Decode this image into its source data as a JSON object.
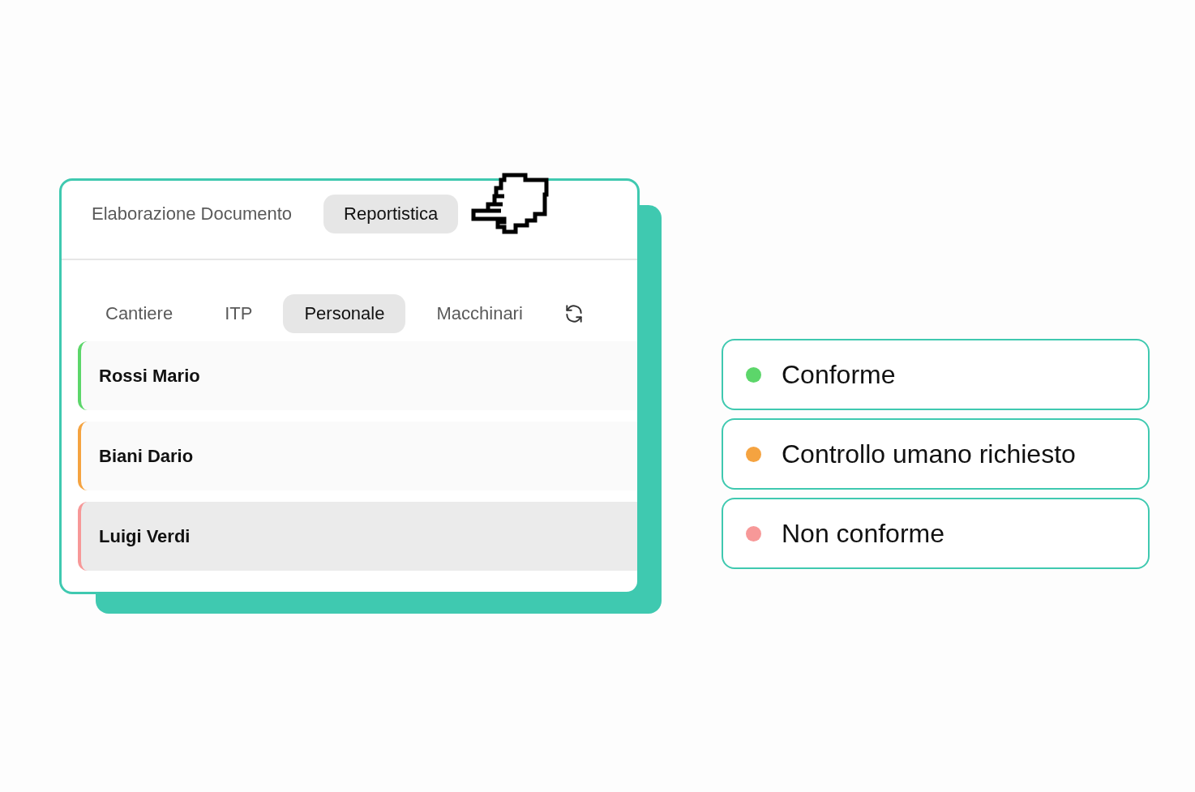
{
  "top_tabs": [
    {
      "label": "Elaborazione Documento",
      "selected": false
    },
    {
      "label": "Reportistica",
      "selected": true
    }
  ],
  "sub_tabs": [
    {
      "label": "Cantiere",
      "selected": false
    },
    {
      "label": "ITP",
      "selected": false
    },
    {
      "label": "Personale",
      "selected": true
    },
    {
      "label": "Macchinari",
      "selected": false
    }
  ],
  "people": [
    {
      "name": "Rossi Mario",
      "color": "#5cd66a",
      "selected": false
    },
    {
      "name": "Biani Dario",
      "color": "#f5a340",
      "selected": false
    },
    {
      "name": "Luigi Verdi",
      "color": "#f79898",
      "selected": true
    }
  ],
  "legend": [
    {
      "label": "Conforme",
      "color": "#5cd66a"
    },
    {
      "label": "Controllo umano richiesto",
      "color": "#f5a340"
    },
    {
      "label": "Non conforme",
      "color": "#f79898"
    }
  ]
}
